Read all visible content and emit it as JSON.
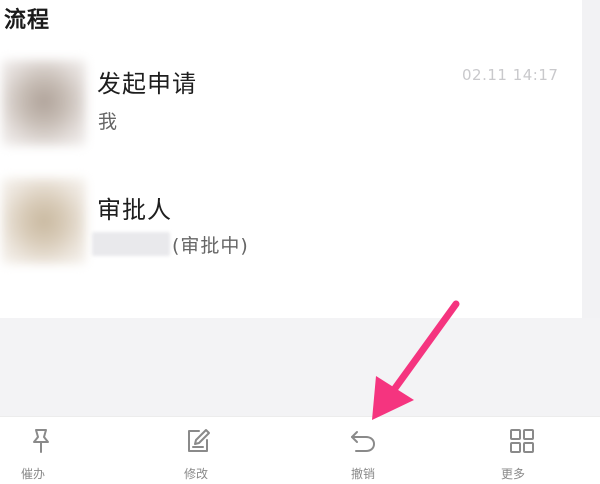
{
  "section": {
    "title": "流程"
  },
  "steps": [
    {
      "title": "发起申请",
      "subtitle": "我",
      "time": "02.11 14:17"
    },
    {
      "title": "审批人",
      "status": "(审批中)"
    }
  ],
  "toolbar": {
    "items": [
      {
        "label": "催办",
        "icon": "pin-icon"
      },
      {
        "label": "修改",
        "icon": "edit-icon"
      },
      {
        "label": "撤销",
        "icon": "undo-icon"
      },
      {
        "label": "更多",
        "icon": "grid-icon"
      }
    ]
  },
  "colors": {
    "arrow": "#f5347f",
    "icon": "#8a8a8a"
  }
}
